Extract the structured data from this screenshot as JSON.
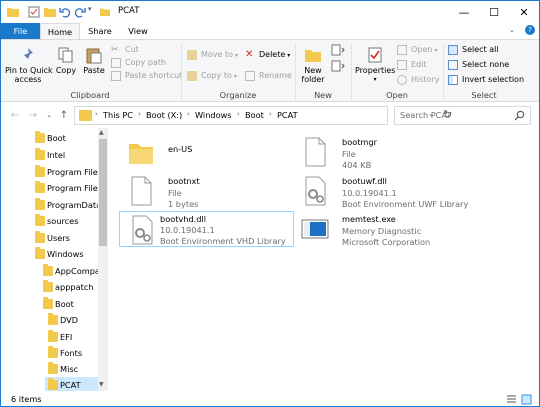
{
  "window": {
    "title": "PCAT",
    "caption_buttons": {
      "minimize": "—",
      "maximize": "☐",
      "close": "✕"
    }
  },
  "ribbon_tabs": [
    "File",
    "Home",
    "Share",
    "View"
  ],
  "ribbon": {
    "clipboard": {
      "label": "Clipboard",
      "pin": "Pin to Quick\naccess",
      "copy": "Copy",
      "paste": "Paste",
      "cut": "Cut",
      "copy_path": "Copy path",
      "paste_shortcut": "Paste shortcut"
    },
    "organize": {
      "label": "Organize",
      "move_to": "Move to",
      "copy_to": "Copy to",
      "delete": "Delete",
      "rename": "Rename"
    },
    "new": {
      "label": "New",
      "new_folder": "New\nfolder"
    },
    "open": {
      "label": "Open",
      "properties": "Properties",
      "open": "Open",
      "edit": "Edit",
      "history": "History"
    },
    "select": {
      "label": "Select",
      "select_all": "Select all",
      "select_none": "Select none",
      "invert_selection": "Invert selection"
    }
  },
  "address": {
    "crumbs": [
      "This PC",
      "Boot (X:)",
      "Windows",
      "Boot",
      "PCAT"
    ],
    "search_placeholder": "Search PCAT"
  },
  "nav_pane": {
    "items": [
      {
        "label": "Boot"
      },
      {
        "label": "Intel"
      },
      {
        "label": "Program Files"
      },
      {
        "label": "Program Files"
      },
      {
        "label": "ProgramData"
      },
      {
        "label": "sources"
      },
      {
        "label": "Users"
      },
      {
        "label": "Windows"
      },
      {
        "label": "AppCompat"
      },
      {
        "label": "apppatch"
      },
      {
        "label": "Boot"
      },
      {
        "label": "DVD"
      },
      {
        "label": "EFI"
      },
      {
        "label": "Fonts"
      },
      {
        "label": "Misc"
      },
      {
        "label": "PCAT"
      }
    ]
  },
  "files": [
    {
      "name": "en-US",
      "line2": "",
      "line3": "",
      "icon": "folder-icon"
    },
    {
      "name": "bootmgr",
      "line2": "File",
      "line3": "404 KB",
      "icon": "file-icon"
    },
    {
      "name": "bootnxt",
      "line2": "File",
      "line3": "1 bytes",
      "icon": "file-icon"
    },
    {
      "name": "bootuwf.dll",
      "line2": "10.0.19041.1",
      "line3": "Boot Environment UWF Library",
      "icon": "dll-icon"
    },
    {
      "name": "bootvhd.dll",
      "line2": "10.0.19041.1",
      "line3": "Boot Environment VHD Library",
      "icon": "dll-icon"
    },
    {
      "name": "memtest.exe",
      "line2": "Memory Diagnostic",
      "line3": "Microsoft Corporation",
      "icon": "exe-icon"
    }
  ],
  "status": {
    "text": "6 items"
  },
  "colors": {
    "accent": "#1979ca",
    "folder": "#f3c94b",
    "selection": "#cce8ff"
  }
}
